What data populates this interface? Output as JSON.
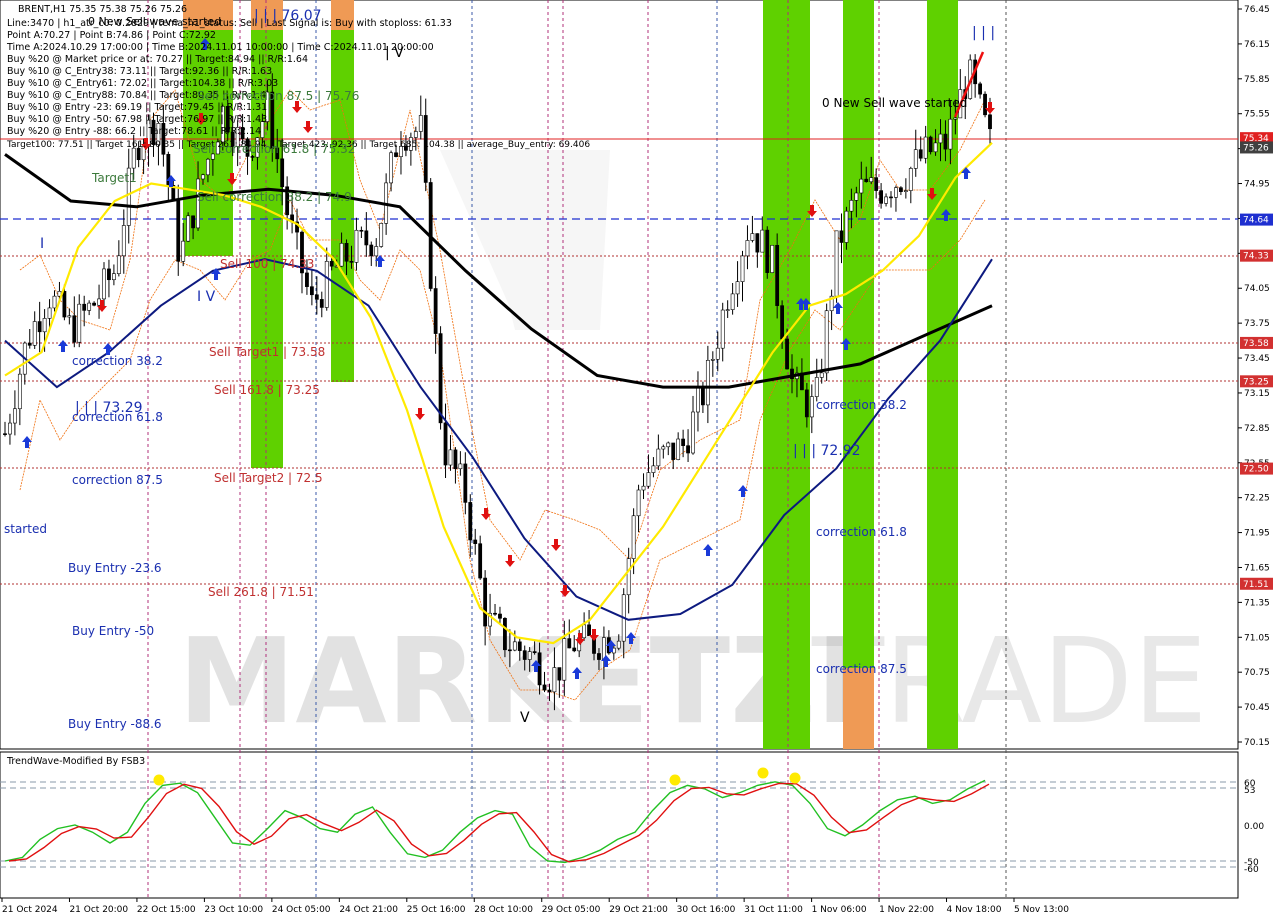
{
  "header": {
    "symbol": "BRENT,H1  75.35 75.38 75.26 75.26",
    "lines": [
      "Line:3470  |  h1_atr_c0: 0.2829  |  tema_h1_status: Sell  |  Last Signal is: Buy with stoploss: 61.33",
      "Point A:70.27  |  Point B:74.86  |  Point C:72.92",
      "Time A:2024.10.29 17:00:00  |  Time B:2024.11.01 10:00:00  |  Time C:2024.11.01 20:00:00",
      "Buy %20 @ Market price or at: 70.27  ||  Target:84.94  ||  R/R:1.64",
      "Buy %10 @ C_Entry38: 73.11  ||  Target:92.36  ||  R/R:1.63",
      "Buy %10 @ C_Entry61: 72.02  ||  Target:104.38  ||  R/R:3.03",
      "Buy %10 @ C_Entry88: 70.84  ||  Target:80.35  ||  R/R:1.4",
      "Buy %10 @ Entry -23: 69.19  ||  Target:79.45  ||  R/R:1.31",
      "Buy %10 @ Entry -50: 67.98  ||  Target:76.97  ||  R/R:1.43",
      "Buy %20 @ Entry -88: 66.2  ||  Target:78.61  ||  R/R:2.14"
    ],
    "targets": "Target100: 77.51  ||  Target 161: 80.35  ||  Target 261: 84.94  ||  Target 423: 92.36  ||  Target 685: 104.38  ||  average_Buy_entry: 69.406"
  },
  "labels": {
    "top_overlap": "0 New Sell wave started",
    "new_sell_wave": "0 New Sell wave started",
    "wave_iii_top": "| | | 76.07",
    "wave_iii_right": "| | |",
    "wave_iv": "| V",
    "wave_iv_b": "I V",
    "wave_i": "I",
    "wave_v": "V",
    "iii_7329": "| | | 73.29",
    "iii_7292": "| | | 72.92",
    "target1": "Target1",
    "started": "started",
    "corr_38_left": "correction 38.2",
    "corr_61_left": "correction 61.8",
    "corr_87_left": "correction 87.5",
    "buy_236": "Buy Entry -23.6",
    "buy_50": "Buy Entry -50",
    "buy_886": "Buy Entry -88.6",
    "sell_100": "Sell 100 | 74.33",
    "sell_t1": "Sell Target1 | 73.58",
    "sell_161": "Sell 161.8 | 73.25",
    "sell_t2": "Sell Target2 | 72.5",
    "sell_261": "Sell  261.8 | 71.51",
    "sell_corr_38": "Sell correction 38.2 | 74.9",
    "sell_corr_61": "Sell correction 61.8 | 75.32",
    "sell_corr_87": "Sell correction 87.5 | 75.76",
    "corr_38_right": "correction 38.2",
    "corr_61_right": "correction 61.8",
    "corr_87_right": "correction 87.5"
  },
  "price_axis": [
    "76.45",
    "76.15",
    "75.85",
    "75.55",
    "75.25",
    "74.95",
    "74.65",
    "74.35",
    "74.05",
    "73.75",
    "73.45",
    "73.15",
    "72.85",
    "72.55",
    "72.25",
    "71.95",
    "71.65",
    "71.35",
    "71.05",
    "70.75",
    "70.45",
    "70.15"
  ],
  "price_tags": [
    {
      "text": "75.34",
      "color": "#e02020"
    },
    {
      "text": "75.26",
      "color": "#404040"
    },
    {
      "text": "74.64",
      "color": "#1e2fd0"
    },
    {
      "text": "74.33",
      "color": "#d23030"
    },
    {
      "text": "73.58",
      "color": "#d23030"
    },
    {
      "text": "73.25",
      "color": "#d23030"
    },
    {
      "text": "72.50",
      "color": "#d23030"
    },
    {
      "text": "71.51",
      "color": "#d23030"
    }
  ],
  "time_axis": [
    "21 Oct 2024",
    "21 Oct 20:00",
    "22 Oct 15:00",
    "23 Oct 10:00",
    "24 Oct 05:00",
    "24 Oct 21:00",
    "25 Oct 16:00",
    "28 Oct 10:00",
    "29 Oct 05:00",
    "29 Oct 21:00",
    "30 Oct 16:00",
    "31 Oct 11:00",
    "1 Nov 06:00",
    "1 Nov 22:00",
    "4 Nov 18:00",
    "5 Nov 13:00"
  ],
  "indicator": {
    "title": "TrendWave-Modified By FSB3",
    "axis": [
      "60",
      "53",
      "0.00",
      "-50",
      "-60"
    ]
  },
  "watermark": {
    "left": "MARKETZI",
    "right": "TRADE"
  },
  "colors": {
    "green_zone": "#5fd100",
    "orange_zone": "#ef9a55",
    "ma_yellow": "#ffea00",
    "ma_black": "#000000",
    "ma_navy": "#0d1a80",
    "sell": "#e01010",
    "buy": "#1a3ad8"
  },
  "chart_data": {
    "type": "line",
    "title": "BRENT,H1",
    "ylim": [
      70.1,
      76.5
    ],
    "series": [
      {
        "name": "Close (approx.)",
        "values": [
          72.8,
          73.6,
          74.0,
          73.7,
          73.9,
          74.2,
          75.3,
          75.5,
          74.3,
          75.0,
          75.6,
          75.2,
          75.6,
          74.6,
          73.9,
          74.2,
          74.4,
          74.5,
          75.4,
          75.4,
          72.7,
          72.3,
          71.2,
          71.0,
          70.9,
          70.7,
          71.0,
          71.0,
          71.1,
          72.4,
          72.6,
          72.7,
          73.2,
          74.0,
          74.6,
          74.3,
          73.2,
          73.0,
          74.4,
          74.9,
          74.9,
          75.0,
          75.2,
          75.3,
          75.9,
          75.3
        ]
      },
      {
        "name": "Moving average (yellow)",
        "values": [
          73.3,
          73.5,
          74.4,
          74.8,
          74.95,
          74.9,
          74.85,
          74.75,
          74.6,
          74.3,
          73.8,
          73.0,
          72.0,
          71.3,
          71.05,
          71.0,
          71.2,
          71.6,
          72.0,
          72.5,
          73.0,
          73.5,
          73.9,
          74.0,
          74.2,
          74.5,
          75.0,
          75.3
        ]
      },
      {
        "name": "Moving average (navy)",
        "values": [
          73.6,
          73.2,
          73.5,
          73.9,
          74.2,
          74.3,
          74.2,
          73.9,
          73.2,
          72.6,
          71.9,
          71.4,
          71.2,
          71.25,
          71.5,
          72.1,
          72.5,
          73.1,
          73.6,
          74.3
        ]
      },
      {
        "name": "Moving average (black)",
        "values": [
          75.2,
          74.8,
          74.75,
          74.85,
          74.9,
          74.85,
          74.75,
          74.2,
          73.7,
          73.3,
          73.2,
          73.2,
          73.3,
          73.4,
          73.65,
          73.9
        ]
      }
    ],
    "levels": [
      75.34,
      75.26,
      74.64,
      74.33,
      73.58,
      73.25,
      72.5,
      71.51
    ]
  }
}
